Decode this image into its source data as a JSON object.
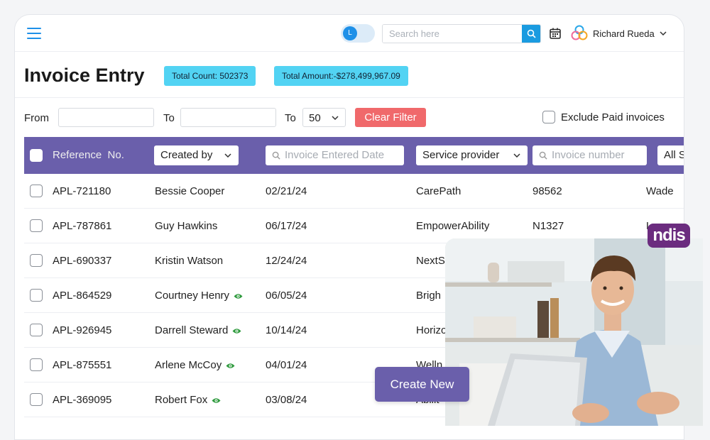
{
  "header": {
    "toggle_letter": "L",
    "search_placeholder": "Search here",
    "user_name": "Richard Rueda"
  },
  "page": {
    "title": "Invoice Entry",
    "total_count": "Total Count: 502373",
    "total_amount": "Total Amount:-$278,499,967.09"
  },
  "filters": {
    "from_label": "From",
    "to_label": "To",
    "to2_label": "To",
    "page_size": "50",
    "clear_label": "Clear Filter",
    "exclude_label": "Exclude Paid invoices"
  },
  "table": {
    "headers": {
      "reference": "Reference  No.",
      "created_by": "Created by",
      "entered_date": "Invoice Entered Date",
      "service_provider": "Service provider",
      "invoice_number": "Invoice number",
      "all_status": "All S"
    },
    "rows": [
      {
        "ref": "APL-721180",
        "created_by": "Bessie Cooper",
        "date": "02/21/24",
        "provider": "CarePath",
        "number": "98562",
        "extra": "Wade"
      },
      {
        "ref": "APL-787861",
        "created_by": "Guy Hawkins",
        "date": "06/17/24",
        "provider": "EmpowerAbility",
        "number": "N1327",
        "extra": "L"
      },
      {
        "ref": "APL-690337",
        "created_by": "Kristin Watson",
        "date": "12/24/24",
        "provider": "NextS",
        "number": "",
        "extra": ""
      },
      {
        "ref": "APL-864529",
        "created_by": "Courtney Henry",
        "date": "06/05/24",
        "provider": "Brigh",
        "number": "",
        "extra": ""
      },
      {
        "ref": "APL-926945",
        "created_by": "Darrell Steward",
        "date": "10/14/24",
        "provider": "Horizo",
        "number": "",
        "extra": ""
      },
      {
        "ref": "APL-875551",
        "created_by": "Arlene McCoy",
        "date": "04/01/24",
        "provider": "Welln",
        "number": "",
        "extra": ""
      },
      {
        "ref": "APL-369095",
        "created_by": "Robert Fox",
        "date": "03/08/24",
        "provider": "Abilit",
        "number": "",
        "extra": ""
      }
    ]
  },
  "create_label": "Create New",
  "ndis_logo": "ndis",
  "colors": {
    "accent": "#1e90e8",
    "header_purple": "#6a5fab",
    "badge_cyan": "#52d3f3",
    "clear_red": "#f0696b",
    "eye_green": "#2e9a3d",
    "ndis_purple": "#6b2c7f"
  }
}
